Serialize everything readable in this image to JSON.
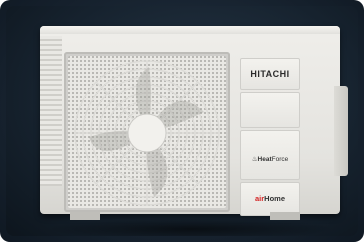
{
  "product": {
    "brand_logo": "HITACHI",
    "series_prefix": "Heat",
    "series_suffix": "Force",
    "sub_brand_air": "air",
    "sub_brand_home": "Home",
    "unit_color": "#e6e5e1",
    "background_color": "#16222e",
    "accent_red": "#d32424"
  }
}
